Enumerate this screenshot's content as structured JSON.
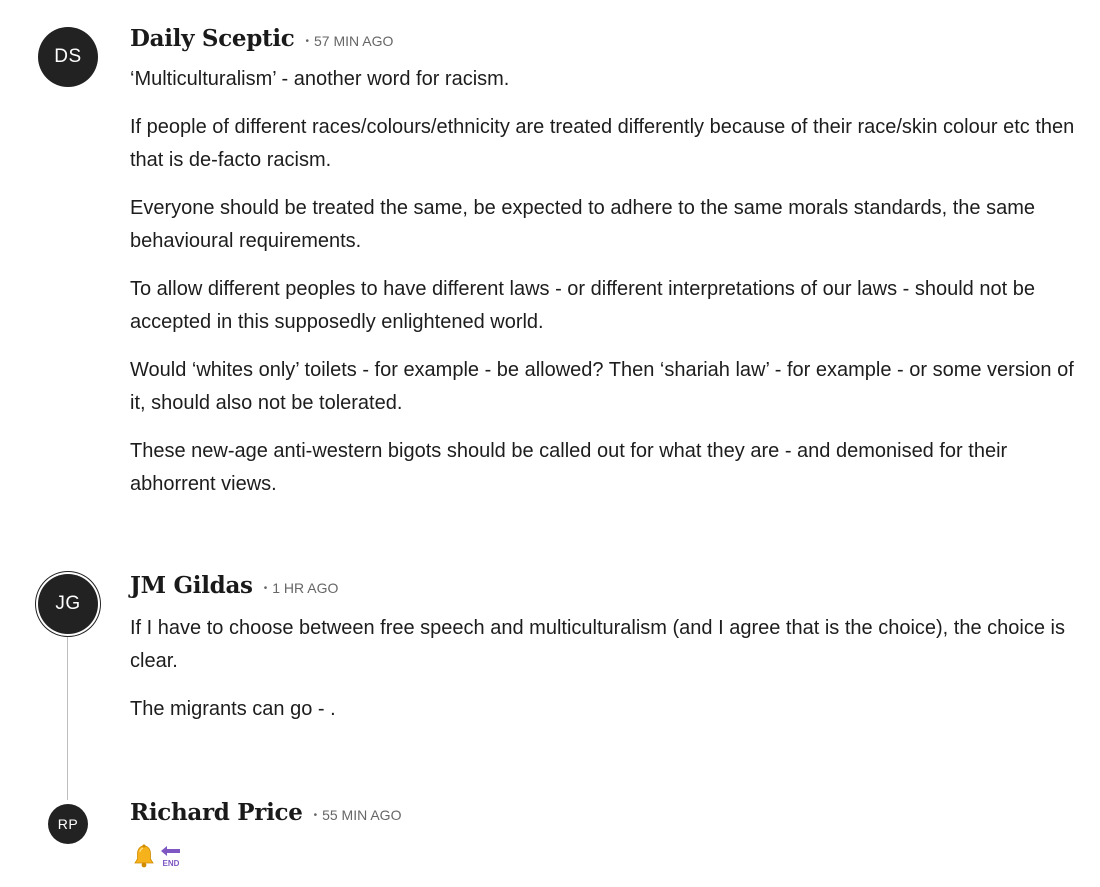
{
  "comments": [
    {
      "initials": "DS",
      "author": "Daily Sceptic",
      "time": "57 MIN AGO",
      "paragraphs": [
        "‘Multiculturalism’ - another word for racism.",
        "If people of different races/colours/ethnicity are treated differently because of their race/skin colour etc then that is de-facto racism.",
        "Everyone should be treated the same, be expected to adhere to the same morals standards, the same behavioural requirements.",
        "To allow different peoples to have different laws - or different interpretations of our laws - should not be accepted in this supposedly enlightened world.",
        "Would ‘whites only’ toilets - for example - be allowed? Then ‘shariah law’ - for example - or some version of it, should also not be tolerated.",
        "These new-age anti-western bigots should be called out for what they are - and demonised for their abhorrent views."
      ]
    },
    {
      "initials": "JG",
      "author": "JM Gildas",
      "time": "1 HR AGO",
      "paragraphs": [
        "If I have to choose between free speech and multiculturalism (and I agree that is the choice), the choice is clear.",
        "The migrants can go - ."
      ]
    },
    {
      "initials": "RP",
      "author": "Richard Price",
      "time": "55 MIN AGO",
      "emojis": [
        "bell-icon",
        "end-arrow-icon"
      ],
      "end_label": "END"
    }
  ],
  "colors": {
    "avatar_bg": "#222222",
    "time_text": "#666666",
    "thread_line": "#bdbdbd",
    "bell": "#f5b21a",
    "end_arrow": "#7e57c2"
  }
}
